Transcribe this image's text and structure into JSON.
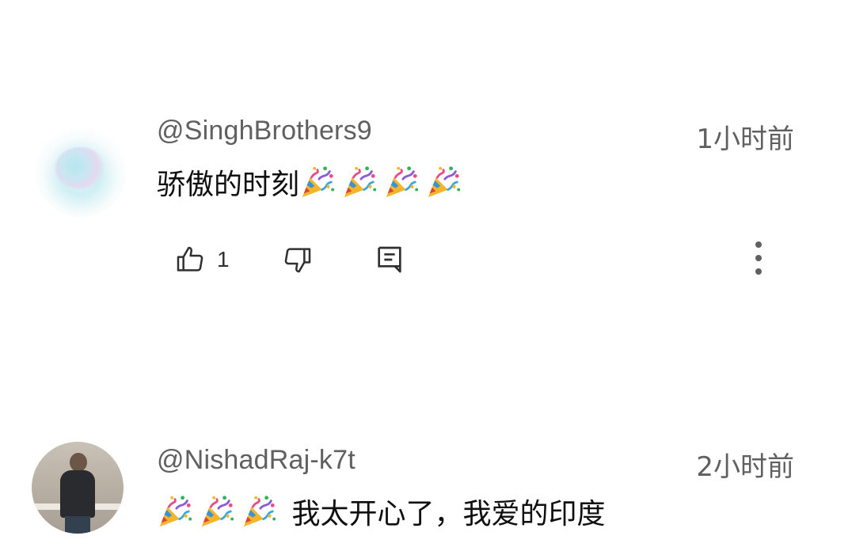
{
  "comments": [
    {
      "username": "@SinghBrothers9",
      "time": "1小时前",
      "text": "骄傲的时刻",
      "emoji_suffix": [
        "party-popper",
        "party-popper",
        "party-popper",
        "party-popper"
      ],
      "likes": "1",
      "avatar": "pastel-watercolor-avatar"
    },
    {
      "username": "@NishadRaj-k7t",
      "time": "2小时前",
      "emoji_prefix": [
        "party-popper",
        "party-popper",
        "party-popper"
      ],
      "text": "我太开心了，我爱的印度",
      "avatar": "person-photo-avatar"
    }
  ],
  "icons": {
    "like": "thumbs-up-icon",
    "dislike": "thumbs-down-icon",
    "reply": "reply-comment-icon",
    "menu": "more-vertical-icon",
    "emoji": "party-popper-icon"
  },
  "colors": {
    "meta_text": "#606060",
    "body_text": "#0f0f0f",
    "icon": "#303030"
  }
}
